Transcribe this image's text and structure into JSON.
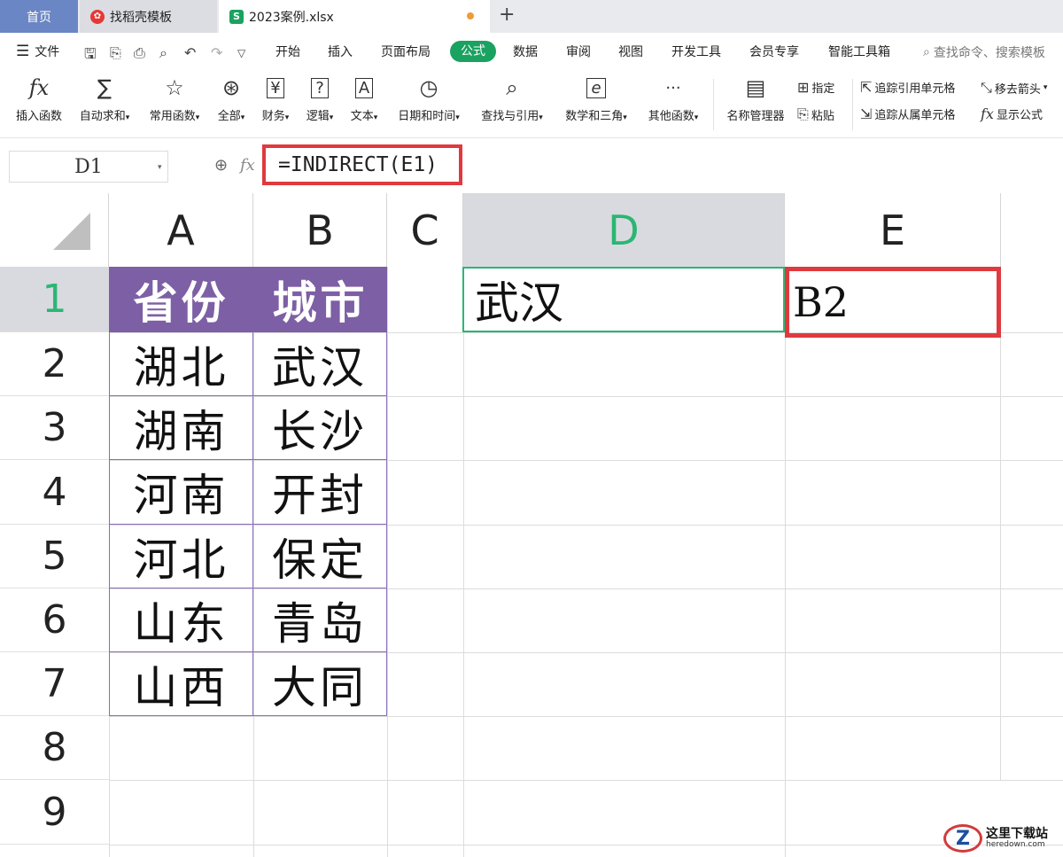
{
  "tabs": {
    "home": "首页",
    "template": "找稻壳模板",
    "file": "2023案例.xlsx",
    "new": "+"
  },
  "menu": {
    "file": "文件",
    "items": [
      "开始",
      "插入",
      "页面布局",
      "公式",
      "数据",
      "审阅",
      "视图",
      "开发工具",
      "会员专享",
      "智能工具箱"
    ],
    "active_index": 3,
    "search": "查找命令、搜索模板"
  },
  "ribbon": {
    "insert_function": "插入函数",
    "autosum": "自动求和",
    "common": "常用函数",
    "all": "全部",
    "finance": "财务",
    "logic": "逻辑",
    "text": "文本",
    "datetime": "日期和时间",
    "lookup": "查找与引用",
    "math": "数学和三角",
    "other": "其他函数",
    "name_mgr": "名称管理器",
    "assign": "指定",
    "paste": "粘贴",
    "trace_precedents": "追踪引用单元格",
    "trace_dependents": "追踪从属单元格",
    "remove_arrows": "移去箭头",
    "show_formula": "显示公式",
    "icons": {
      "finance_glyph": "¥",
      "logic_glyph": "?",
      "text_glyph": "A",
      "math_glyph": "e",
      "other_glyph": "···"
    }
  },
  "formula_bar": {
    "name_box": "D1",
    "fx": "fx",
    "formula": "=INDIRECT(E1)"
  },
  "sheet": {
    "columns": [
      "A",
      "B",
      "C",
      "D",
      "E"
    ],
    "selected_column": "D",
    "rows": [
      "1",
      "2",
      "3",
      "4",
      "5",
      "6",
      "7",
      "8",
      "9"
    ],
    "selected_row": "1",
    "table_header": [
      "省份",
      "城市"
    ],
    "table_rows": [
      [
        "湖北",
        "武汉"
      ],
      [
        "湖南",
        "长沙"
      ],
      [
        "河南",
        "开封"
      ],
      [
        "河北",
        "保定"
      ],
      [
        "山东",
        "青岛"
      ],
      [
        "山西",
        "大同"
      ]
    ],
    "d1": "武汉",
    "e1": "B2"
  },
  "watermark": {
    "logo": "Z",
    "cn": "这里下载站",
    "en": "heredown.com"
  },
  "colors": {
    "accent_green": "#1aa260",
    "header_purple": "#7d5fa5",
    "highlight_red": "#e0393e"
  }
}
